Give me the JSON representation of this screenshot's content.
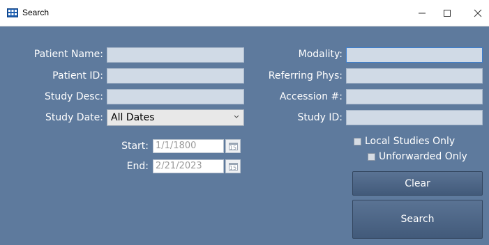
{
  "window": {
    "title": "Search",
    "minimize_glyph": "—",
    "maximize_glyph": "☐",
    "close_glyph": "✕",
    "icon": "app-grid-icon"
  },
  "left": {
    "patient_name_label": "Patient Name:",
    "patient_id_label": "Patient ID:",
    "study_desc_label": "Study Desc:",
    "study_date_label": "Study Date:",
    "patient_name_value": "",
    "patient_id_value": "",
    "study_desc_value": "",
    "study_date_selected": "All Dates",
    "start_label": "Start:",
    "start_value": "1/1/1800",
    "end_label": "End:",
    "end_value": "2/21/2023",
    "calendar_glyph": "15"
  },
  "right": {
    "modality_label": "Modality:",
    "referring_label": "Referring Phys:",
    "accession_label": "Accession #:",
    "study_id_label": "Study ID:",
    "modality_value": "",
    "referring_value": "",
    "accession_value": "",
    "study_id_value": "",
    "local_only_label": "Local Studies Only",
    "local_only_checked": false,
    "unforwarded_label": "Unforwarded Only",
    "unforwarded_checked": false
  },
  "buttons": {
    "clear_label": "Clear",
    "search_label": "Search"
  },
  "colors": {
    "background": "#5e7a9d",
    "field": "#d0dae6",
    "button": "#4a6384"
  }
}
